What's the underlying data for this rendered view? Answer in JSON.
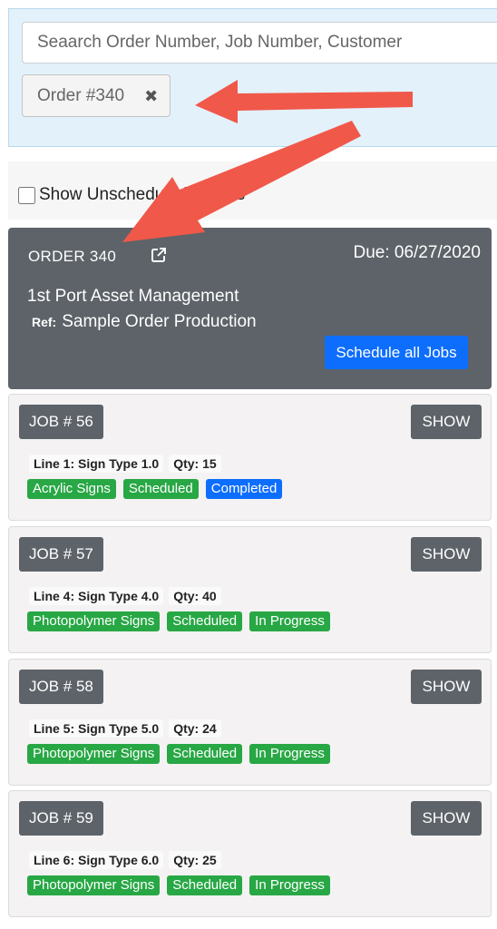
{
  "search": {
    "placeholder": "Seaarch Order Number, Job Number, Customer",
    "chip_label": "Order #340",
    "chip_close": "✖"
  },
  "filters": {
    "unscheduled_label": "Show Unscheduled Orders"
  },
  "order": {
    "title": "ORDER 340",
    "due": "Due: 06/27/2020",
    "customer": "1st Port Asset Management",
    "ref_label": "Ref:",
    "ref_value": "Sample Order Production",
    "schedule_label": "Schedule all Jobs"
  },
  "jobs": [
    {
      "title": "JOB # 56",
      "show": "SHOW",
      "line": "Line 1: Sign Type 1.0",
      "qty": "Qty: 15",
      "tags": [
        {
          "text": "Acrylic Signs",
          "color": "#28a745"
        },
        {
          "text": "Scheduled",
          "color": "#28a745"
        },
        {
          "text": "Completed",
          "color": "#0d6efd"
        }
      ]
    },
    {
      "title": "JOB # 57",
      "show": "SHOW",
      "line": "Line 4: Sign Type 4.0",
      "qty": "Qty: 40",
      "tags": [
        {
          "text": "Photopolymer Signs",
          "color": "#28a745"
        },
        {
          "text": "Scheduled",
          "color": "#28a745"
        },
        {
          "text": "In Progress",
          "color": "#28a745"
        }
      ]
    },
    {
      "title": "JOB # 58",
      "show": "SHOW",
      "line": "Line 5: Sign Type 5.0",
      "qty": "Qty: 24",
      "tags": [
        {
          "text": "Photopolymer Signs",
          "color": "#28a745"
        },
        {
          "text": "Scheduled",
          "color": "#28a745"
        },
        {
          "text": "In Progress",
          "color": "#28a745"
        }
      ]
    },
    {
      "title": "JOB # 59",
      "show": "SHOW",
      "line": "Line 6: Sign Type 6.0",
      "qty": "Qty: 25",
      "tags": [
        {
          "text": "Photopolymer Signs",
          "color": "#28a745"
        },
        {
          "text": "Scheduled",
          "color": "#28a745"
        },
        {
          "text": "In Progress",
          "color": "#28a745"
        }
      ]
    }
  ],
  "colors": {
    "accent": "#0d6efd",
    "success": "#28a745",
    "card_dark": "#5d6369",
    "annotation_arrow": "#f0584a"
  },
  "icons": {
    "chip_close": "close-icon",
    "order_link": "external-link-icon",
    "annotation": "arrow-annotation-icon"
  }
}
